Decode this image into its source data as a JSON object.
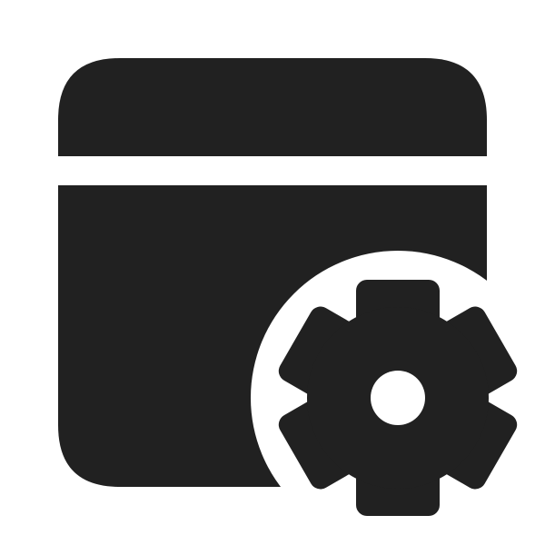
{
  "icon": {
    "name": "app-window-settings-icon",
    "color": "#212121",
    "background": "#ffffff"
  }
}
